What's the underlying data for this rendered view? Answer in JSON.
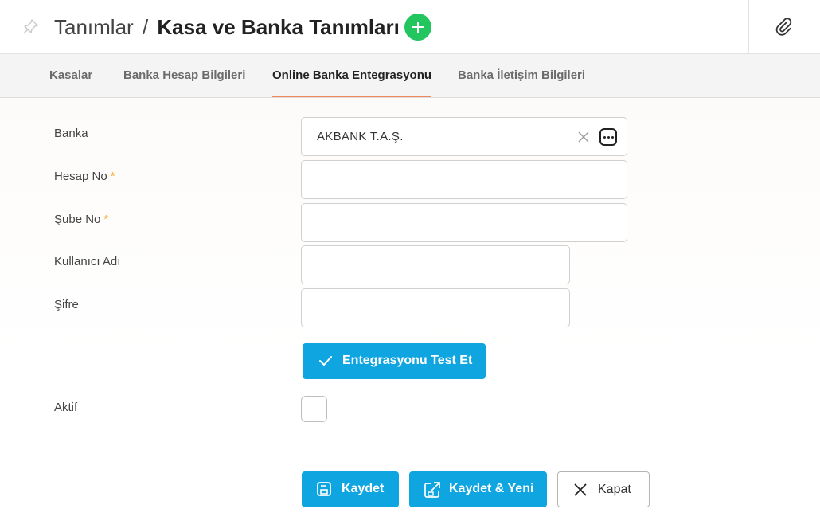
{
  "header": {
    "breadcrumb_parent": "Tanımlar",
    "separator": "/",
    "title": "Kasa ve Banka Tanımları"
  },
  "tabs": [
    {
      "label": "Kasalar",
      "active": false
    },
    {
      "label": "Banka Hesap Bilgileri",
      "active": false
    },
    {
      "label": "Online Banka Entegrasyonu",
      "active": true
    },
    {
      "label": "Banka İletişim Bilgileri",
      "active": false
    }
  ],
  "form": {
    "banka": {
      "label": "Banka",
      "value": "AKBANK T.A.Ş."
    },
    "hesap_no": {
      "label": "Hesap No",
      "required_mark": "*",
      "value": ""
    },
    "sube_no": {
      "label": "Şube No",
      "required_mark": "*",
      "value": ""
    },
    "kullanici_adi": {
      "label": "Kullanıcı Adı",
      "value": ""
    },
    "sifre": {
      "label": "Şifre",
      "value": ""
    },
    "test_button": "Entegrasyonu Test Et",
    "aktif": {
      "label": "Aktif",
      "checked": false
    }
  },
  "actions": {
    "save": "Kaydet",
    "save_new": "Kaydet & Yeni",
    "close": "Kapat"
  },
  "icons": {
    "pin": "pin-icon",
    "add": "plus-icon",
    "attach": "paperclip-icon",
    "clear": "close-icon",
    "more": "ellipsis-icon",
    "check": "check-icon",
    "save": "floppy-icon",
    "save_new": "export-icon",
    "close": "x-icon"
  },
  "colors": {
    "primary": "#0ea5e0",
    "add": "#22c55e",
    "tab_underline": "#f08a5d",
    "required": "#f5a623"
  }
}
